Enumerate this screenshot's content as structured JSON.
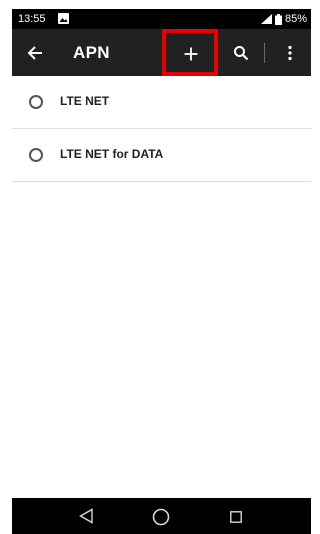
{
  "status_bar": {
    "time": "13:55",
    "battery": "85%"
  },
  "toolbar": {
    "title": "APN",
    "actions": [
      "back",
      "add",
      "search",
      "more"
    ]
  },
  "apn_list": [
    {
      "label": "LTE NET",
      "selected": false
    },
    {
      "label": "LTE NET for DATA",
      "selected": false
    }
  ],
  "nav_bar": {
    "buttons": [
      "back",
      "home",
      "recents"
    ]
  },
  "colors": {
    "toolbar_bg": "#212121",
    "status_bg": "#000000",
    "highlight": "#e60000",
    "divider": "#dddddd"
  }
}
